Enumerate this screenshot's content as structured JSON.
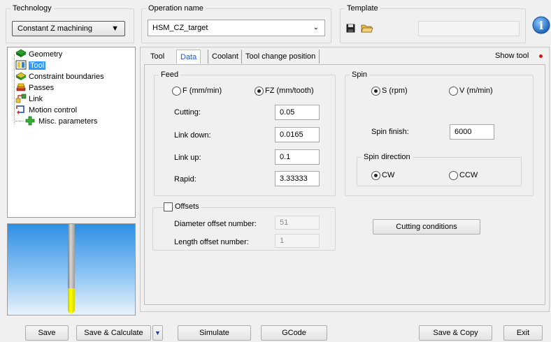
{
  "technology": {
    "legend": "Technology",
    "selected": "Constant Z machining"
  },
  "operation": {
    "legend": "Operation name",
    "value": "HSM_CZ_target"
  },
  "template": {
    "legend": "Template",
    "value": ""
  },
  "tree": {
    "items": [
      {
        "label": "Geometry"
      },
      {
        "label": "Tool"
      },
      {
        "label": "Constraint boundaries"
      },
      {
        "label": "Passes"
      },
      {
        "label": "Link"
      },
      {
        "label": "Motion control"
      },
      {
        "label": "Misc. parameters"
      }
    ],
    "selected_index": 1
  },
  "tabs": {
    "items": [
      "Tool",
      "Data",
      "Coolant",
      "Tool change position"
    ],
    "active_index": 1,
    "show_tool": "Show tool"
  },
  "feed": {
    "legend": "Feed",
    "radio_f": "F (mm/min)",
    "radio_fz": "FZ (mm/tooth)",
    "selected": "FZ (mm/tooth)",
    "cutting_label": "Cutting:",
    "cutting_value": "0.05",
    "link_down_label": "Link down:",
    "link_down_value": "0.0165",
    "link_up_label": "Link up:",
    "link_up_value": "0.1",
    "rapid_label": "Rapid:",
    "rapid_value": "3.33333"
  },
  "spin": {
    "legend": "Spin",
    "radio_s": "S (rpm)",
    "radio_v": "V (m/min)",
    "selected": "S (rpm)",
    "finish_label": "Spin finish:",
    "finish_value": "6000",
    "direction_legend": "Spin direction",
    "cw": "CW",
    "ccw": "CCW",
    "direction_selected": "CW"
  },
  "offsets": {
    "label": "Offsets",
    "checked": false,
    "diameter_label": "Diameter offset number:",
    "diameter_value": "51",
    "length_label": "Length offset number:",
    "length_value": "1"
  },
  "cutting_conditions": "Cutting conditions",
  "footer": {
    "save": "Save",
    "save_calculate": "Save & Calculate",
    "simulate": "Simulate",
    "gcode": "GCode",
    "save_copy": "Save & Copy",
    "exit": "Exit"
  },
  "colors": {
    "selection": "#3399ff",
    "tab_active": "#1a5bd6",
    "tool_tip": "#ffff00",
    "preview_sky": "#2f8ee6"
  }
}
